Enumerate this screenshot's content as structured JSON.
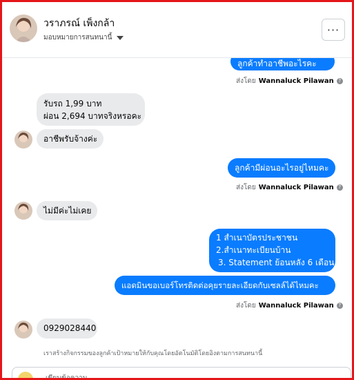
{
  "header": {
    "name": "วราภรณ์ เพ็งกล้า",
    "subtitle": "มอบหมายการสนทนานี้",
    "more_label": "···"
  },
  "messages": [
    {
      "type": "out",
      "text": "ลูกค้าทำอาชีพอะไรคะ"
    },
    {
      "type": "sent_by",
      "prefix": "ส่งโดย",
      "name": "Wannaluck Pilawan"
    },
    {
      "type": "in",
      "lines": [
        "รับรถ 1,99 บาท",
        "ผ่อน 2,694 บาทจริงหรอคะ"
      ]
    },
    {
      "type": "in",
      "text": "อาชีพรับจ้างค่ะ"
    },
    {
      "type": "out",
      "text": "ลูกค้ามีผ่อนอะไรอยู่ไหมคะ"
    },
    {
      "type": "sent_by",
      "prefix": "ส่งโดย",
      "name": "Wannaluck Pilawan"
    },
    {
      "type": "in",
      "text": "ไม่มีค่ะไม่เคย"
    },
    {
      "type": "out",
      "lines": [
        "1 สำเนาบัตรประชาชน",
        "2.สำเนาทะเบียนบ้าน",
        "3. Statement ย้อนหลัง 6 เดือน"
      ]
    },
    {
      "type": "out",
      "text": "แอดมินขอเบอร์โทรติดต่อคุยรายละเอียดกับเซลล์ได้ไหมคะ"
    },
    {
      "type": "sent_by",
      "prefix": "ส่งโดย",
      "name": "Wannaluck Pilawan"
    },
    {
      "type": "in",
      "text": "0929028440"
    }
  ],
  "footer_note": "เราสร้างกิจกรรมของลูกค้าเป้าหมายให้กับคุณโดยอัตโนมัติโดยอิงตามการสนทนานี้",
  "composer": {
    "placeholder": "เขียนข้อความ..."
  },
  "colors": {
    "accent": "#0a7cff",
    "incoming": "#e9eaec",
    "border": "#e4161a"
  }
}
